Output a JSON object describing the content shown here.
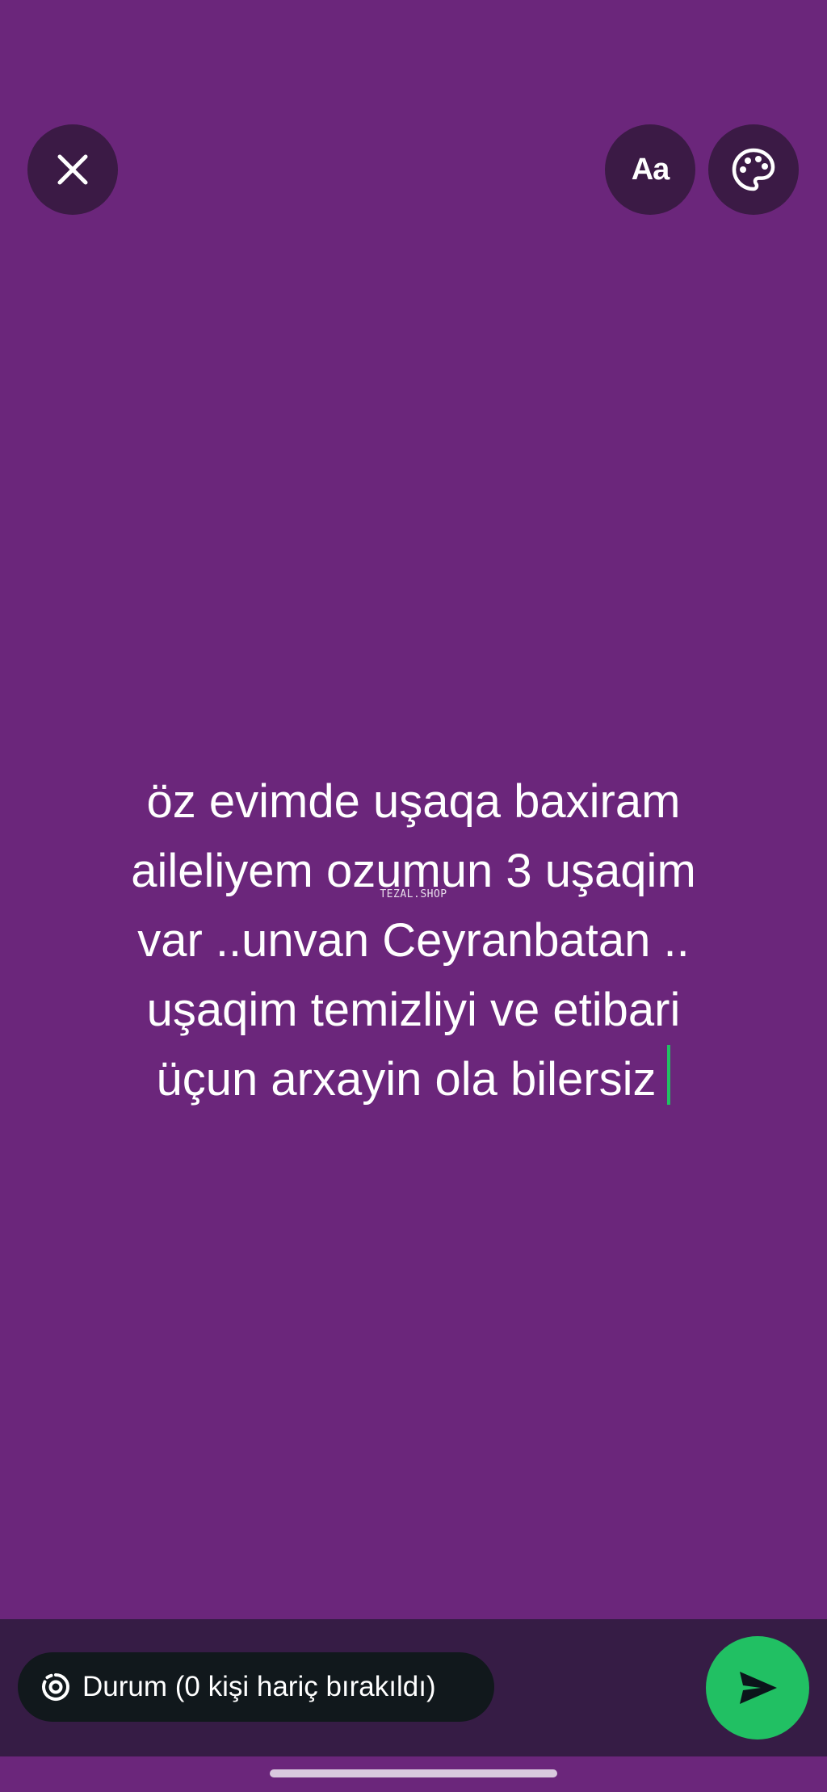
{
  "composer": {
    "status_text": "öz evimde uşaqa baxiram\naileliyem ozumun 3 uşaqim\nvar ..unvan Ceyranbatan ..\nuşaqim temizliyi ve etibari\nüçun arxayin ola bilersiz",
    "watermark": "TEZAL.SHOP",
    "background_color": "#6b267b"
  },
  "toolbar": {
    "close_icon": "close-icon",
    "font_label": "Aa",
    "palette_icon": "palette-icon"
  },
  "bottom": {
    "audience_icon": "status-ring-icon",
    "audience_label": "Durum (0 kişi hariç bırakıldı)",
    "send_icon": "send-icon",
    "send_color": "#21c063"
  }
}
